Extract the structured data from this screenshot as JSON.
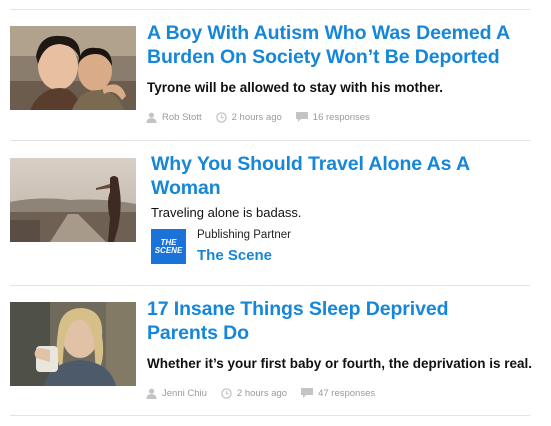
{
  "articles": [
    {
      "title": "A Boy With Autism Who Was Deemed A Burden On Society Won’t Be Deported",
      "dek": "Tyrone will be allowed to stay with his mother.",
      "author": "Rob Stott",
      "time": "2 hours ago",
      "responses": "16 responses"
    },
    {
      "title": "Why You Should Travel Alone As A Woman",
      "dek": "Traveling alone is badass.",
      "partner_label": "Publishing Partner",
      "partner_name": "The Scene",
      "partner_logo_line1": "THE",
      "partner_logo_line2": "SCENE"
    },
    {
      "title": "17 Insane Things Sleep Deprived Parents Do",
      "dek": "Whether it’s your first baby or fourth, the deprivation is real.",
      "author": "Jenni Chiu",
      "time": "2 hours ago",
      "responses": "47 responses"
    }
  ],
  "icons": {
    "author": "person-icon",
    "time": "clock-icon",
    "responses": "speech-bubble-icon"
  },
  "colors": {
    "title": "#1687d8",
    "partner_logo": "#1a73d9",
    "meta": "#9a9a9a"
  }
}
